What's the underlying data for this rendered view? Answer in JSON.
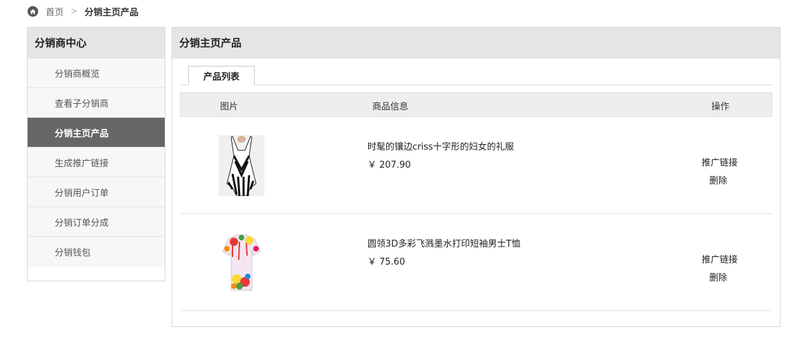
{
  "breadcrumb": {
    "home": "首页",
    "separator": ">",
    "current": "分销主页产品"
  },
  "sidebar": {
    "title": "分销商中心",
    "items": [
      {
        "label": "分销商概览"
      },
      {
        "label": "查看子分销商"
      },
      {
        "label": "分销主页产品",
        "active": true
      },
      {
        "label": "生成推广链接"
      },
      {
        "label": "分销用户订单"
      },
      {
        "label": "分销订单分成"
      },
      {
        "label": "分销钱包"
      }
    ]
  },
  "panel": {
    "title": "分销主页产品",
    "tab": "产品列表",
    "columns": {
      "image": "图片",
      "info": "商品信息",
      "actions": "操作"
    },
    "rows": [
      {
        "name": "时髦的镶边criss十字形的妇女的礼服",
        "price": "￥ 207.90",
        "promote": "推广链接",
        "delete": "删除",
        "image_icon": "striped-dress-icon"
      },
      {
        "name": "圆领3D多彩飞溅墨水打印短袖男士T恤",
        "price": "￥ 75.60",
        "promote": "推广链接",
        "delete": "删除",
        "image_icon": "paint-splash-tshirt-icon"
      }
    ]
  },
  "colors": {
    "active_bg": "#666666",
    "header_bg": "#e5e5e5",
    "table_head_bg": "#eeeeee"
  }
}
